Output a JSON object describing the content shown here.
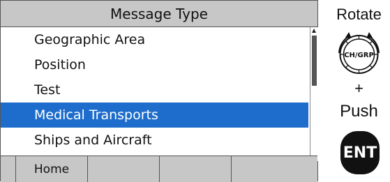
{
  "screen": {
    "title": "Message Type",
    "items": [
      {
        "label": "Geographic Area"
      },
      {
        "label": "Position"
      },
      {
        "label": "Test"
      },
      {
        "label": "Medical Transports"
      },
      {
        "label": "Ships and Aircraft"
      }
    ],
    "selected_index": 3,
    "softkeys": [
      "Home",
      "",
      "",
      ""
    ]
  },
  "controls": {
    "rotate_label": "Rotate",
    "knob_label": "CH/GRP",
    "plus_label": "+",
    "push_label": "Push",
    "ent_label": "ENT"
  },
  "colors": {
    "selection": "#1e6dcc",
    "title_bar": "#c7c7c7",
    "softkey_bar": "#c7c7c7"
  },
  "icons": [
    "scroll-up-arrow-icon",
    "scroll-down-arrow-icon",
    "rotate-arrows-icon",
    "knob-icon"
  ]
}
